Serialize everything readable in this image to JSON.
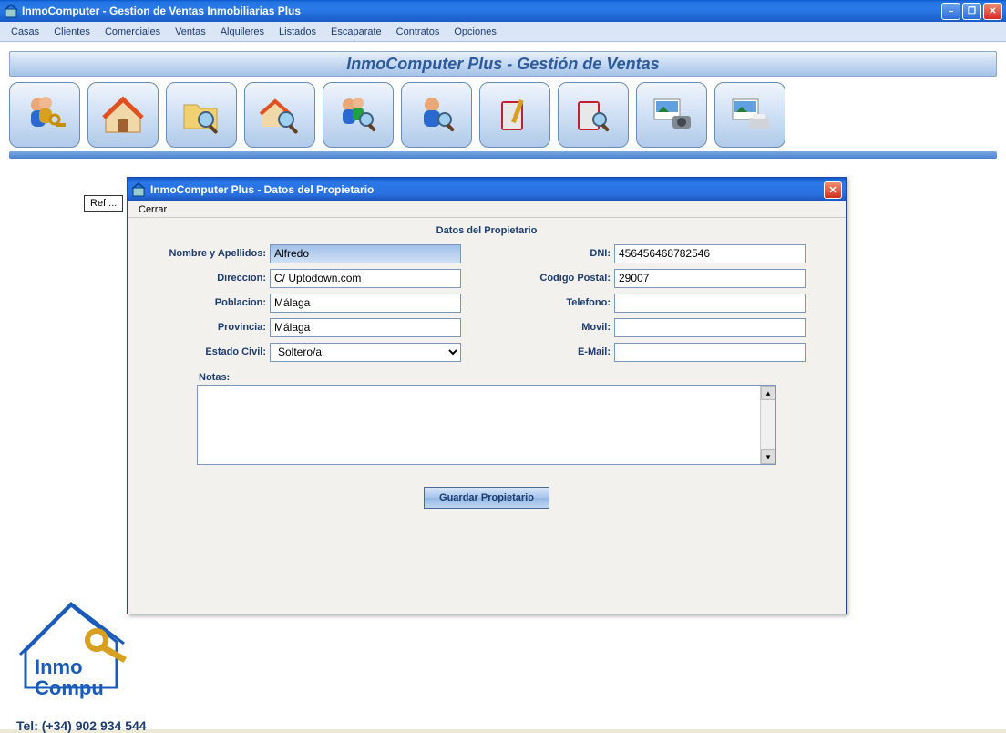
{
  "main_window": {
    "title": "InmoComputer - Gestion de Ventas Inmobiliarias Plus"
  },
  "menu": {
    "items": [
      "Casas",
      "Clientes",
      "Comerciales",
      "Ventas",
      "Alquileres",
      "Listados",
      "Escaparate",
      "Contratos",
      "Opciones"
    ]
  },
  "banner": {
    "text": "InmoComputer Plus - Gestión de Ventas"
  },
  "toolbar": {
    "buttons": [
      {
        "name": "users-keys-icon"
      },
      {
        "name": "house-icon"
      },
      {
        "name": "folder-search-icon"
      },
      {
        "name": "house-search-icon"
      },
      {
        "name": "users-search-icon"
      },
      {
        "name": "user-search-icon"
      },
      {
        "name": "book-pencil-icon"
      },
      {
        "name": "book-search-icon"
      },
      {
        "name": "photo-camera-icon"
      },
      {
        "name": "photo-print-icon"
      }
    ],
    "tooltip": "Ref ..."
  },
  "dialog": {
    "title": "InmoComputer Plus - Datos del Propietario",
    "menu": {
      "cerrar": "Cerrar"
    },
    "heading": "Datos del Propietario",
    "labels": {
      "nombre": "Nombre y Apellidos:",
      "direccion": "Direccion:",
      "poblacion": "Poblacion:",
      "provincia": "Provincia:",
      "estado_civil": "Estado Civil:",
      "dni": "DNI:",
      "codigo_postal": "Codigo Postal:",
      "telefono": "Telefono:",
      "movil": "Movil:",
      "email": "E-Mail:",
      "notas": "Notas:"
    },
    "values": {
      "nombre": "Alfredo",
      "direccion": "C/ Uptodown.com",
      "poblacion": "Málaga",
      "provincia": "Málaga",
      "estado_civil": "Soltero/a",
      "dni": "456456468782546",
      "codigo_postal": "29007",
      "telefono": "",
      "movil": "",
      "email": "",
      "notas": ""
    },
    "save_button": "Guardar Propietario"
  },
  "footer": {
    "tel": "Tel: (+34) 902 934 544"
  },
  "logo": {
    "line1": "Inmo",
    "line2": "Compu"
  }
}
